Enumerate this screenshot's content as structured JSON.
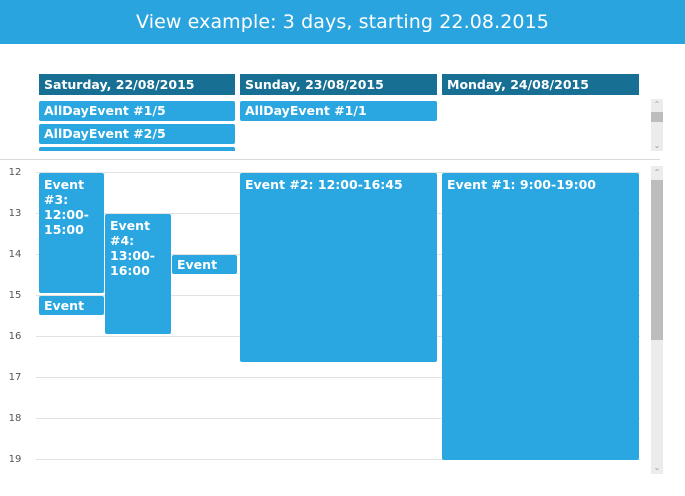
{
  "header": {
    "title": "View example: 3 days, starting 22.08.2015"
  },
  "days": [
    {
      "label": "Saturday, 22/08/2015"
    },
    {
      "label": "Sunday, 23/08/2015"
    },
    {
      "label": "Monday, 24/08/2015"
    }
  ],
  "all_day_events": [
    {
      "label": "AllDayEvent #1/5"
    },
    {
      "label": "AllDayEvent #2/5"
    },
    {
      "label": "AllDayEvent #1/1"
    }
  ],
  "hours": [
    "12",
    "13",
    "14",
    "15",
    "16",
    "17",
    "18",
    "19"
  ],
  "events": [
    {
      "label": "Event #3: 12:00-15:00"
    },
    {
      "label": "Event #4: 13:00-16:00"
    },
    {
      "label": "Event"
    },
    {
      "label": "Event"
    },
    {
      "label": "Event #2: 12:00-16:45"
    },
    {
      "label": "Event #1: 9:00-19:00"
    }
  ]
}
